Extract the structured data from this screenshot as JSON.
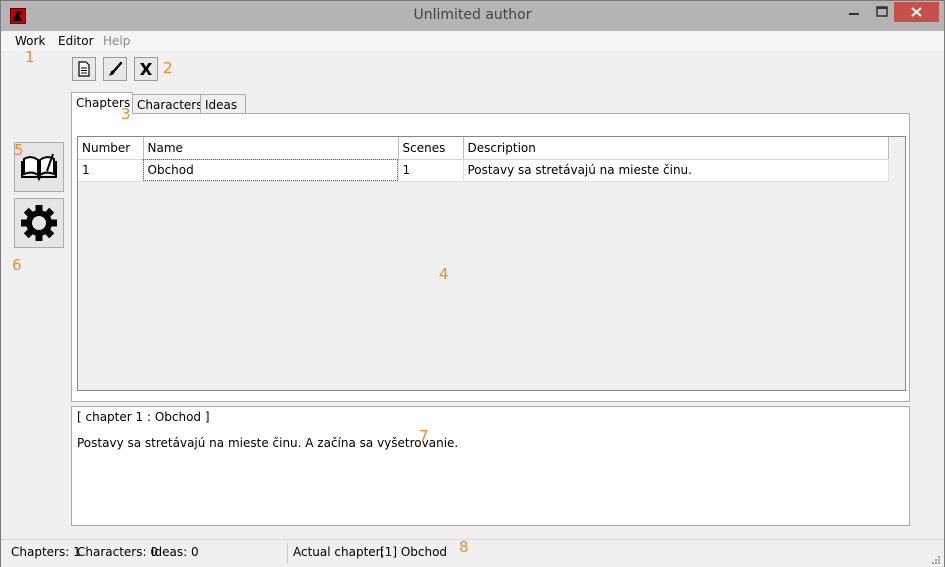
{
  "window": {
    "title": "Unlimited author",
    "app_icon": "app-logo-icon",
    "accent": "#c7504b"
  },
  "menu": {
    "items": [
      "Work",
      "Editor",
      "Help"
    ]
  },
  "toolbar": {
    "icons": [
      "document-icon",
      "brush-icon",
      "close-x-icon"
    ]
  },
  "tabs": {
    "items": [
      "Chapters",
      "Characters",
      "Ideas"
    ],
    "active": "Chapters"
  },
  "grid": {
    "columns": [
      "Number",
      "Name",
      "Scenes",
      "Description"
    ],
    "rows": [
      [
        "1",
        "Obchod",
        "1",
        "Postavy sa stretávajú na mieste činu."
      ]
    ]
  },
  "sidebar": {
    "icons": [
      "book-icon",
      "gear-icon"
    ]
  },
  "detail": {
    "header": "[ chapter 1 : Obchod ]",
    "text": "Postavy sa stretávajú na mieste činu. A začína sa vyšetrovanie."
  },
  "status": {
    "chapters": "Chapters: 1",
    "characters": "Characters: 0",
    "ideas": "Ideas: 0",
    "actual_label": "Actual chapter:",
    "actual_value": "[1] Obchod"
  },
  "annotations": [
    "1",
    "2",
    "3",
    "4",
    "5",
    "6",
    "7",
    "8"
  ]
}
